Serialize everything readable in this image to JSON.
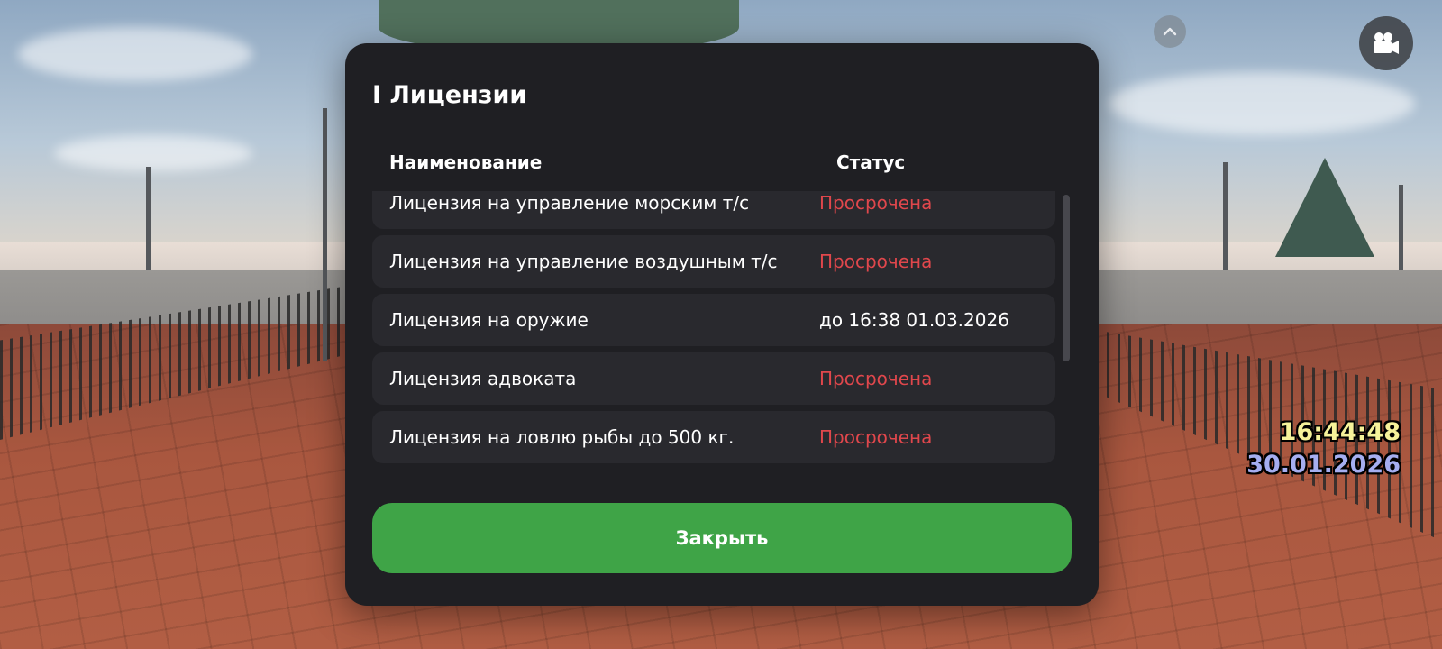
{
  "modal": {
    "title": "I Лицензии",
    "columns": {
      "name": "Наименование",
      "status": "Статус"
    },
    "licenses": [
      {
        "name": "Лицензия на управление морским т/с",
        "status": "Просрочена",
        "expired": true
      },
      {
        "name": "Лицензия на управление воздушным т/с",
        "status": "Просрочена",
        "expired": true
      },
      {
        "name": "Лицензия на оружие",
        "status": "до 16:38 01.03.2026",
        "expired": false
      },
      {
        "name": "Лицензия адвоката",
        "status": "Просрочена",
        "expired": true
      },
      {
        "name": "Лицензия на ловлю рыбы до 500 кг.",
        "status": "Просрочена",
        "expired": true
      }
    ],
    "close_label": "Закрыть"
  },
  "hud": {
    "time": "16:44:48",
    "date": "30.01.2026",
    "icons": [
      "chevron-up-icon",
      "video-camera-icon"
    ]
  },
  "colors": {
    "panel_bg": "#1f1f23",
    "row_bg": "#29292e",
    "expired": "#e0474c",
    "button": "#3fa447",
    "clock_time": "#f6f29a",
    "clock_date": "#a5aef0"
  }
}
